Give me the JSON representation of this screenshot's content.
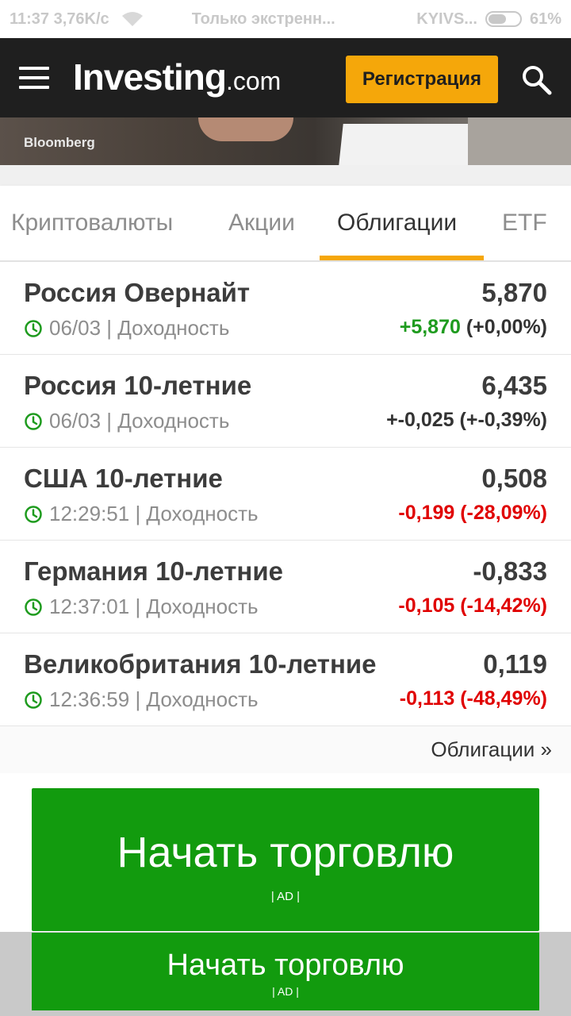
{
  "status_bar": {
    "time_speed": "11:37 3,76K/c",
    "notice": "Только экстренн...",
    "carrier": "KYIVS...",
    "battery": "61%"
  },
  "header": {
    "logo_brand": "Investing",
    "logo_suffix": ".com",
    "register_label": "Регистрация"
  },
  "banner": {
    "label": "Bloomberg"
  },
  "tabs": [
    {
      "label": "Криптовалюты",
      "active": false
    },
    {
      "label": "Акции",
      "active": false
    },
    {
      "label": "Облигации",
      "active": true
    },
    {
      "label": "ETF",
      "active": false
    }
  ],
  "bonds": [
    {
      "name": "Россия Овернайт",
      "value": "5,870",
      "time": "06/03",
      "type_label": "Доходность",
      "change": "+5,870",
      "change_pct": "(+0,00%)",
      "direction": "pos"
    },
    {
      "name": "Россия 10-летние",
      "value": "6,435",
      "time": "06/03",
      "type_label": "Доходность",
      "change": "+-0,025",
      "change_pct": "(+-0,39%)",
      "direction": "neu"
    },
    {
      "name": "США 10-летние",
      "value": "0,508",
      "time": "12:29:51",
      "type_label": "Доходность",
      "change": "-0,199",
      "change_pct": "(-28,09%)",
      "direction": "neg"
    },
    {
      "name": "Германия 10-летние",
      "value": "-0,833",
      "time": "12:37:01",
      "type_label": "Доходность",
      "change": "-0,105",
      "change_pct": "(-14,42%)",
      "direction": "neg"
    },
    {
      "name": "Великобритания 10-летние",
      "value": "0,119",
      "time": "12:36:59",
      "type_label": "Доходность",
      "change": "-0,113",
      "change_pct": "(-48,49%)",
      "direction": "neg"
    }
  ],
  "more_link": "Облигации »",
  "ads": {
    "title": "Начать торговлю",
    "tag": "| AD |"
  },
  "colors": {
    "accent": "#f5a70a",
    "header_bg": "#1f1f1f",
    "positive": "#1e9b1e",
    "negative": "#e00000",
    "ad_green": "#129b0e"
  },
  "icons": [
    "menu-icon",
    "search-icon",
    "clock-icon",
    "wifi-icon",
    "battery-icon"
  ]
}
